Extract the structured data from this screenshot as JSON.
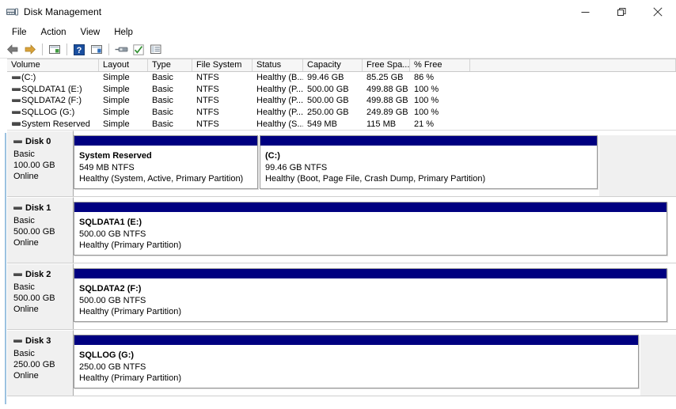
{
  "window": {
    "title": "Disk Management",
    "icon": "disk-management-icon",
    "controls": {
      "minimize": "Minimize",
      "restore": "Restore",
      "close": "Close"
    }
  },
  "menubar": {
    "items": [
      {
        "label": "File"
      },
      {
        "label": "Action"
      },
      {
        "label": "View"
      },
      {
        "label": "Help"
      }
    ]
  },
  "toolbar": {
    "buttons": [
      {
        "name": "back-icon",
        "tip": "Back"
      },
      {
        "name": "forward-icon",
        "tip": "Forward"
      },
      {
        "name": "show-hide-console-tree-icon",
        "tip": "Show/Hide Console Tree"
      },
      {
        "name": "help-icon",
        "tip": "Help"
      },
      {
        "name": "show-hide-action-pane-icon",
        "tip": "Show/Hide Action Pane"
      },
      {
        "name": "properties-icon",
        "tip": "Properties"
      },
      {
        "name": "rescan-disks-icon",
        "tip": "Rescan Disks"
      },
      {
        "name": "list-view-icon",
        "tip": "List View"
      }
    ]
  },
  "volume_table": {
    "columns": [
      {
        "key": "volume",
        "label": "Volume"
      },
      {
        "key": "layout",
        "label": "Layout"
      },
      {
        "key": "type",
        "label": "Type"
      },
      {
        "key": "filesystem",
        "label": "File System"
      },
      {
        "key": "status",
        "label": "Status"
      },
      {
        "key": "capacity",
        "label": "Capacity"
      },
      {
        "key": "freespace",
        "label": "Free Spa..."
      },
      {
        "key": "pctfree",
        "label": "% Free"
      }
    ],
    "rows": [
      {
        "volume": "(C:)",
        "layout": "Simple",
        "type": "Basic",
        "filesystem": "NTFS",
        "status": "Healthy (B...",
        "capacity": "99.46 GB",
        "freespace": "85.25 GB",
        "pctfree": "86 %"
      },
      {
        "volume": "SQLDATA1 (E:)",
        "layout": "Simple",
        "type": "Basic",
        "filesystem": "NTFS",
        "status": "Healthy (P...",
        "capacity": "500.00 GB",
        "freespace": "499.88 GB",
        "pctfree": "100 %"
      },
      {
        "volume": "SQLDATA2 (F:)",
        "layout": "Simple",
        "type": "Basic",
        "filesystem": "NTFS",
        "status": "Healthy (P...",
        "capacity": "500.00 GB",
        "freespace": "499.88 GB",
        "pctfree": "100 %"
      },
      {
        "volume": "SQLLOG (G:)",
        "layout": "Simple",
        "type": "Basic",
        "filesystem": "NTFS",
        "status": "Healthy (P...",
        "capacity": "250.00 GB",
        "freespace": "249.89 GB",
        "pctfree": "100 %"
      },
      {
        "volume": "System Reserved",
        "layout": "Simple",
        "type": "Basic",
        "filesystem": "NTFS",
        "status": "Healthy (S...",
        "capacity": "549 MB",
        "freespace": "115 MB",
        "pctfree": "21 %"
      }
    ]
  },
  "disks": [
    {
      "name": "Disk 0",
      "type": "Basic",
      "size": "100.00 GB",
      "state": "Online",
      "partitions": [
        {
          "name": "System Reserved",
          "size_fs": "549 MB NTFS",
          "health": "Healthy (System, Active, Primary Partition)",
          "bar_color": "#000080",
          "width_pct": 34
        },
        {
          "name": "(C:)",
          "size_fs": "99.46 GB NTFS",
          "health": "Healthy (Boot, Page File, Crash Dump, Primary Partition)",
          "bar_color": "#000080",
          "width_pct": 63
        }
      ],
      "trailing_gap_pct": 3
    },
    {
      "name": "Disk 1",
      "type": "Basic",
      "size": "500.00 GB",
      "state": "Online",
      "partitions": [
        {
          "name": "SQLDATA1  (E:)",
          "size_fs": "500.00 GB NTFS",
          "health": "Healthy (Primary Partition)",
          "bar_color": "#000080",
          "width_pct": 100
        }
      ],
      "trailing_gap_pct": 0
    },
    {
      "name": "Disk 2",
      "type": "Basic",
      "size": "500.00 GB",
      "state": "Online",
      "partitions": [
        {
          "name": "SQLDATA2  (F:)",
          "size_fs": "500.00 GB NTFS",
          "health": "Healthy (Primary Partition)",
          "bar_color": "#000080",
          "width_pct": 100
        }
      ],
      "trailing_gap_pct": 0
    },
    {
      "name": "Disk 3",
      "type": "Basic",
      "size": "250.00 GB",
      "state": "Online",
      "partitions": [
        {
          "name": "SQLLOG  (G:)",
          "size_fs": "250.00 GB NTFS",
          "health": "Healthy (Primary Partition)",
          "bar_color": "#000080",
          "width_pct": 94
        }
      ],
      "trailing_gap_pct": 6
    }
  ],
  "colors": {
    "partition_bar": "#000080",
    "panel_bg": "#f0f0f0",
    "accent_line": "#9cc2e0"
  }
}
